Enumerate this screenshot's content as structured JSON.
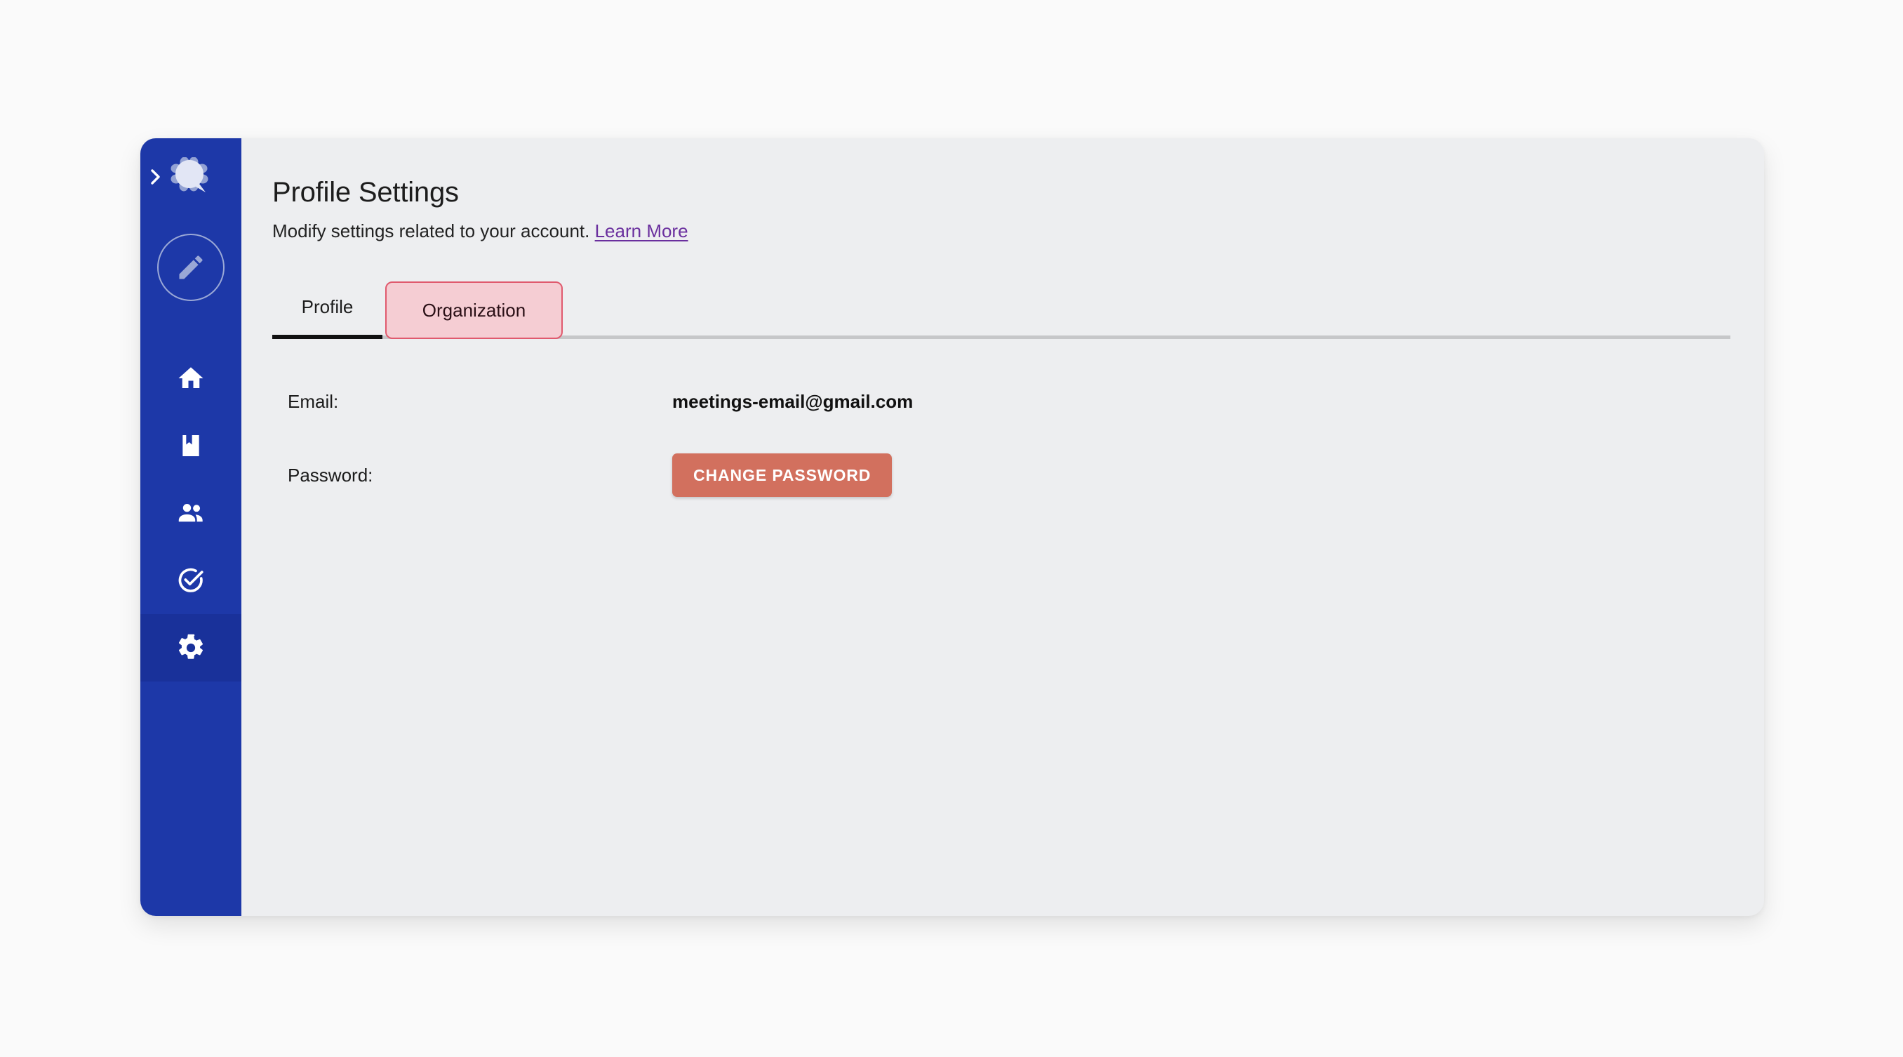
{
  "window": {
    "background_color": "#edeef0",
    "page_background_color": "#fafafa"
  },
  "sidebar": {
    "background_color": "#1d38a8",
    "active_background_color": "#19319a",
    "expand_chevron": "chevron-right-icon",
    "logo": "speech-bubble-flower-logo",
    "avatar": {
      "icon": "pencil-icon",
      "label": "Edit profile avatar"
    },
    "items": [
      {
        "icon": "home-icon",
        "label": "Home",
        "active": false
      },
      {
        "icon": "book-bookmark-icon",
        "label": "Library",
        "active": false
      },
      {
        "icon": "people-icon",
        "label": "People",
        "active": false
      },
      {
        "icon": "check-circle-icon",
        "label": "Tasks",
        "active": false
      },
      {
        "icon": "gear-icon",
        "label": "Settings",
        "active": true
      }
    ]
  },
  "header": {
    "title": "Profile Settings",
    "subtitle_text": "Modify settings related to your account.",
    "link_label": "Learn More",
    "link_color": "#6a2f9e"
  },
  "tabs": {
    "items": [
      {
        "label": "Profile",
        "active": true
      },
      {
        "label": "Organization",
        "active": false,
        "highlighted": true
      }
    ],
    "highlight_fill": "#f5cdd3",
    "highlight_border": "#e05a6e",
    "active_underline_color": "#111111",
    "divider_color": "#c6c7c9"
  },
  "form": {
    "rows": [
      {
        "label": "Email:",
        "value": "meetings-email@gmail.com",
        "type": "text"
      },
      {
        "label": "Password:",
        "button_label": "CHANGE PASSWORD",
        "type": "button"
      }
    ],
    "button_color": "#d2705e"
  }
}
